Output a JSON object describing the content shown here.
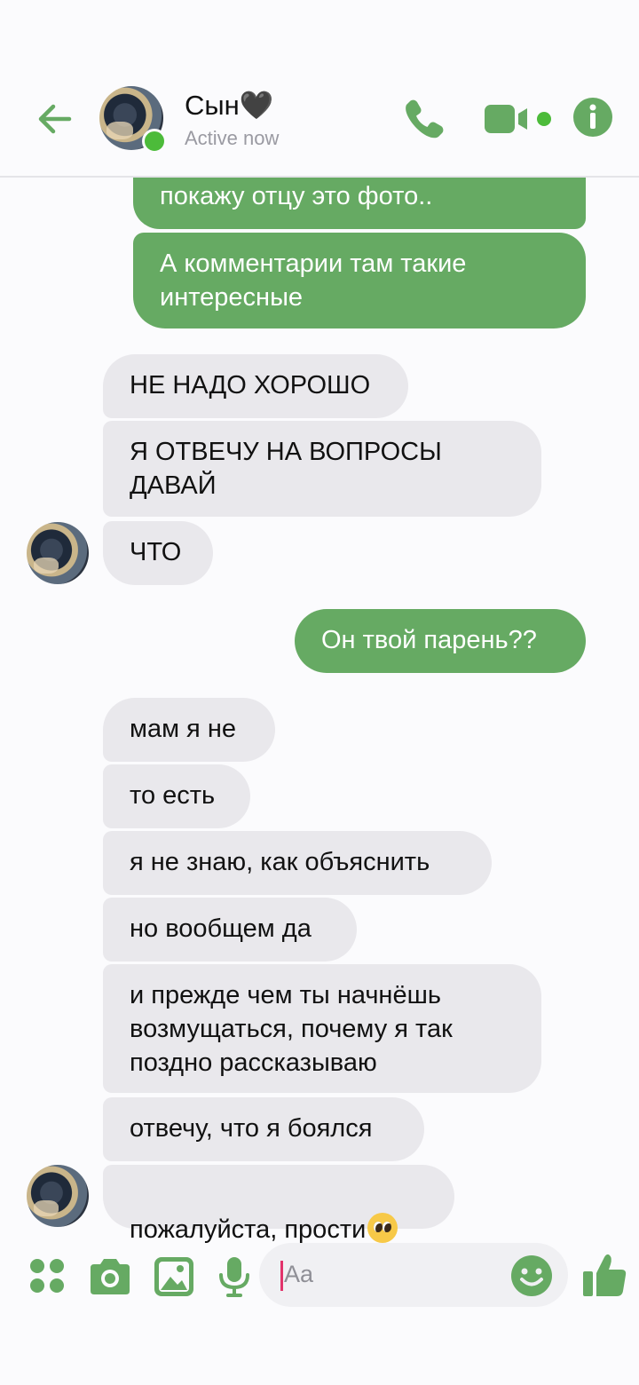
{
  "header": {
    "contact_name": "Сын🖤",
    "status": "Active now"
  },
  "messages": [
    {
      "side": "out",
      "text": "покажу отцу это фото.."
    },
    {
      "side": "out",
      "text": "А комментарии там такие\nинтересные"
    },
    {
      "side": "in",
      "text": "НЕ НАДО ХОРОШО"
    },
    {
      "side": "in",
      "text": "Я ОТВЕЧУ НА ВОПРОСЫ\nДАВАЙ"
    },
    {
      "side": "in",
      "text": "ЧТО"
    },
    {
      "side": "out",
      "text": "Он твой парень??"
    },
    {
      "side": "in",
      "text": "мам я не"
    },
    {
      "side": "in",
      "text": "то есть"
    },
    {
      "side": "in",
      "text": "я не знаю, как объяснить"
    },
    {
      "side": "in",
      "text": "но вообщем да"
    },
    {
      "side": "in",
      "text": "и прежде чем ты начнёшь\nвозмущаться, почему я так\nпоздно рассказываю"
    },
    {
      "side": "in",
      "text": "отвечу, что я боялся"
    },
    {
      "side": "in",
      "text": "пожалуйста, прости",
      "emoji": "pleading-face"
    }
  ],
  "composer": {
    "placeholder": "Aa"
  },
  "colors": {
    "accent": "#66aa63",
    "incoming_bubble": "#e9e8ec",
    "online": "#4cbb3a"
  },
  "icons": [
    "back-arrow-icon",
    "phone-icon",
    "video-camera-icon",
    "info-icon",
    "apps-icon",
    "camera-icon",
    "gallery-icon",
    "microphone-icon",
    "emoji-icon",
    "thumbs-up-icon"
  ]
}
